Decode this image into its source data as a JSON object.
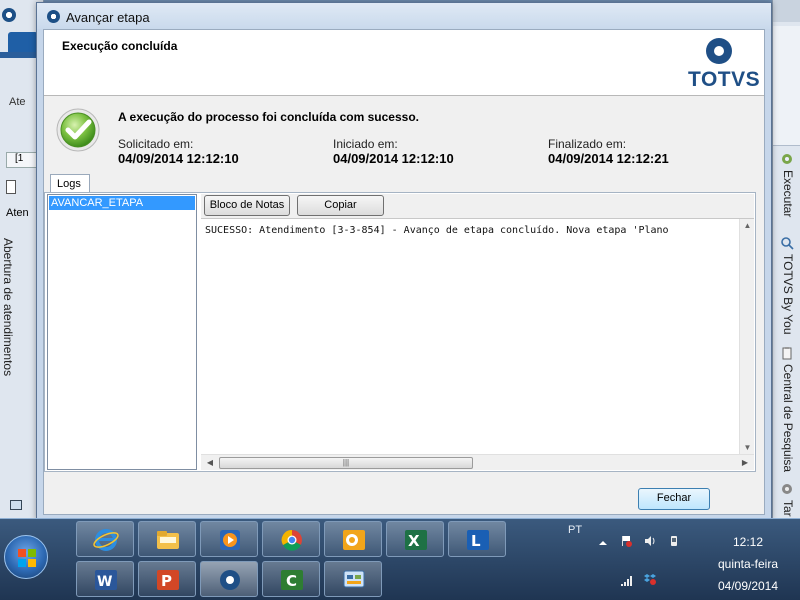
{
  "dialog": {
    "title": "Avançar etapa",
    "header_title": "Execução concluída",
    "logo_text": "TOTVS",
    "message": "A execução do processo foi concluída com sucesso.",
    "requested": {
      "label": "Solicitado em:",
      "value": "04/09/2014 12:12:10"
    },
    "started": {
      "label": "Iniciado em:",
      "value": "04/09/2014 12:12:10"
    },
    "finished": {
      "label": "Finalizado em:",
      "value": "04/09/2014 12:12:21"
    },
    "logs_tab": "Logs",
    "log_items": [
      "AVANCAR_ETAPA"
    ],
    "notepad_button": "Bloco de Notas",
    "copy_button": "Copiar",
    "log_text": "SUCESSO: Atendimento [3-3-854] - Avanço de etapa concluído. Nova etapa 'Plano",
    "close_button": "Fechar"
  },
  "background_left": {
    "ate": "Ate",
    "tab": "[1",
    "atend": "Aten",
    "vertical": "Abertura de atendimentos"
  },
  "background_right": {
    "tabs": [
      "Executar",
      "TOTVS By You",
      "Central de Pesquisa",
      "Tar"
    ]
  },
  "taskbar": {
    "language": "PT",
    "time": "12:12",
    "weekday": "quinta-feira",
    "date": "04/09/2014",
    "apps": [
      "internet-explorer",
      "windows-explorer",
      "media-player",
      "chrome",
      "outlook",
      "excel",
      "lync",
      "word",
      "powerpoint",
      "totvs",
      "camtasia",
      "control-panel"
    ]
  }
}
